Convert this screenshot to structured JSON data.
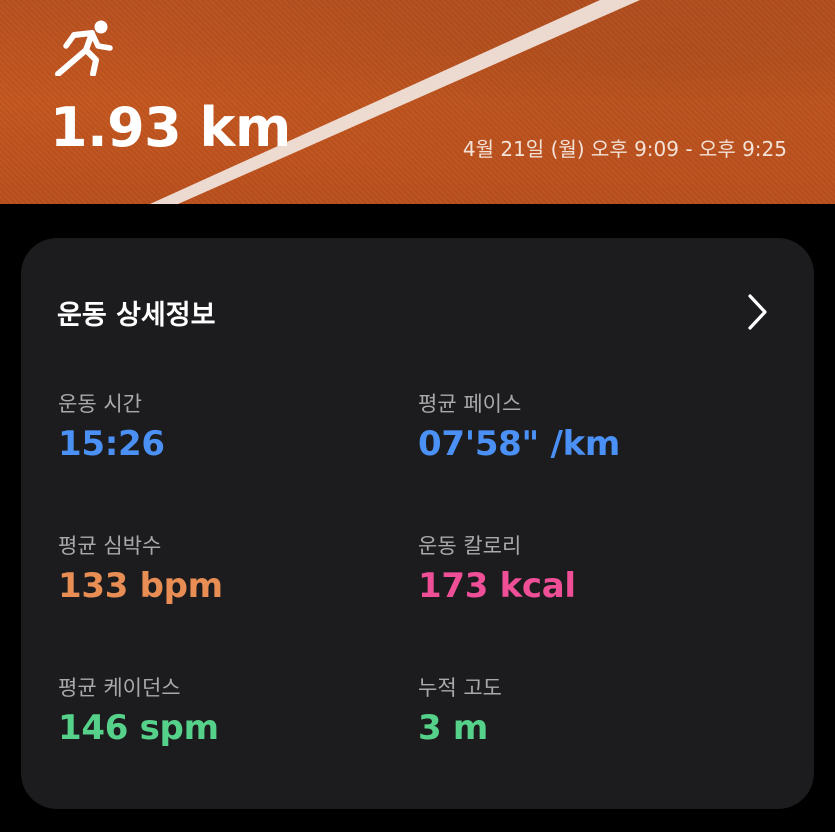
{
  "hero": {
    "icon": "running-person-icon",
    "distance": "1.93 km",
    "datetime": "4월 21일 (월) 오후 9:09 - 오후 9:25"
  },
  "card": {
    "title": "운동 상세정보",
    "chevron_icon": "chevron-right-icon",
    "metrics": [
      {
        "label": "운동 시간",
        "value": "15:26",
        "color": "#4a90f5"
      },
      {
        "label": "평균 페이스",
        "value": "07'58\" /km",
        "color": "#4a90f5"
      },
      {
        "label": "평균 심박수",
        "value": "133 bpm",
        "color": "#e88e55"
      },
      {
        "label": "운동 칼로리",
        "value": "173 kcal",
        "color": "#ee4f97"
      },
      {
        "label": "평균 케이던스",
        "value": "146 spm",
        "color": "#55d18a"
      },
      {
        "label": "누적 고도",
        "value": "3 m",
        "color": "#55d18a"
      }
    ]
  },
  "colors": {
    "hero_background": "#c4561f",
    "card_background": "#1c1c1e",
    "page_background": "#000000"
  }
}
